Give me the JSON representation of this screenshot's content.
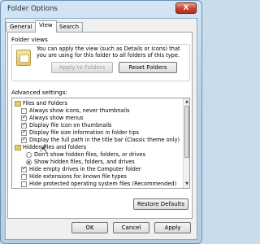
{
  "window": {
    "title": "Folder Options",
    "close_glyph": "X"
  },
  "tabs": [
    {
      "label": "General"
    },
    {
      "label": "View"
    },
    {
      "label": "Search"
    }
  ],
  "folder_views": {
    "heading": "Folder views",
    "description_line1": "You can apply the view (such as Details or Icons) that",
    "description_line2": "you are using for this folder to all folders of this type.",
    "apply_button": "Apply to Folders",
    "reset_button": "Reset Folders"
  },
  "advanced": {
    "heading": "Advanced settings:",
    "rows": [
      {
        "kind": "folder",
        "label": "Files and Folders",
        "checked": false
      },
      {
        "kind": "checkbox",
        "label": "Always show icons, never thumbnails",
        "checked": false
      },
      {
        "kind": "checkbox",
        "label": "Always show menus",
        "checked": true
      },
      {
        "kind": "checkbox",
        "label": "Display file icon on thumbnails",
        "checked": true
      },
      {
        "kind": "checkbox",
        "label": "Display file size information in folder tips",
        "checked": true
      },
      {
        "kind": "checkbox",
        "label": "Display the full path in the title bar (Classic theme only)",
        "checked": true
      },
      {
        "kind": "folder",
        "label": "Hidden files and folders",
        "checked": false
      },
      {
        "kind": "radio",
        "label": "Don't show hidden files, folders, or drives",
        "checked": false
      },
      {
        "kind": "radio",
        "label": "Show hidden files, folders, and drives",
        "checked": true
      },
      {
        "kind": "checkbox",
        "label": "Hide empty drives in the Computer folder",
        "checked": true
      },
      {
        "kind": "checkbox",
        "label": "Hide extensions for known file types",
        "checked": false
      },
      {
        "kind": "checkbox",
        "label": "Hide protected operating system files (Recommended)",
        "checked": false
      }
    ],
    "restore_button": "Restore Defaults"
  },
  "footer": {
    "ok": "OK",
    "cancel": "Cancel",
    "apply": "Apply"
  }
}
